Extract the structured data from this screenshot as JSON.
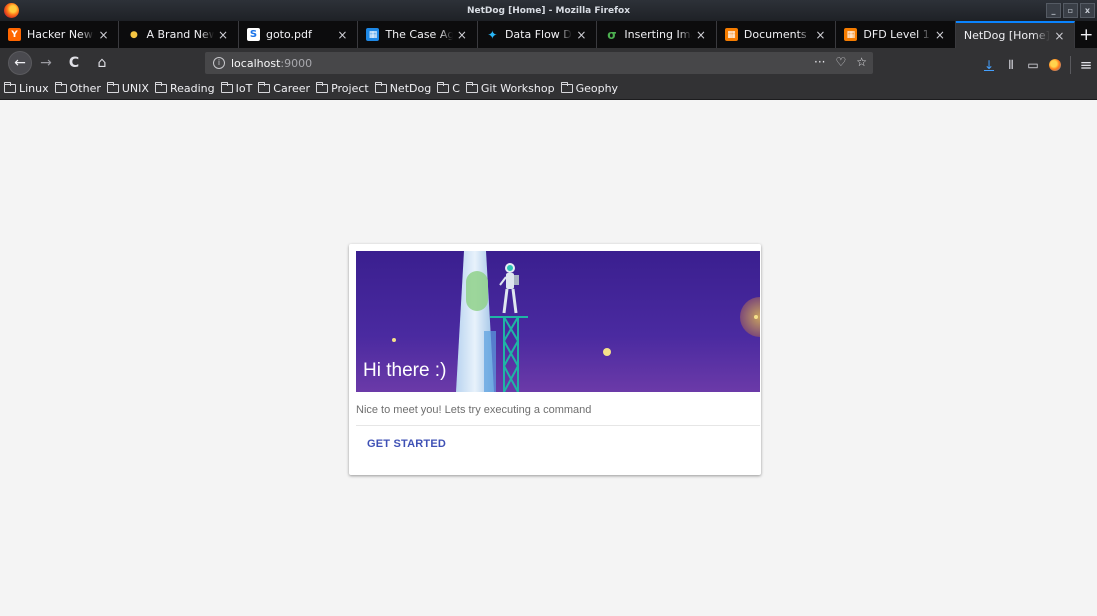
{
  "window": {
    "title": "NetDog [Home] - Mozilla Firefox",
    "controls": [
      "_",
      "▫",
      "x"
    ]
  },
  "tabs": [
    {
      "label": "Hacker News",
      "icon": "hacker-news-icon",
      "color": "#ff6600",
      "glyph": "Y"
    },
    {
      "label": "A Brand New",
      "icon": "lightbulb-icon",
      "color": "#f5c542",
      "glyph": "●"
    },
    {
      "label": "goto.pdf",
      "icon": "scribd-icon",
      "color": "#1a73e8",
      "glyph": "S"
    },
    {
      "label": "The Case Ag",
      "icon": "case-icon",
      "color": "#1e88e5",
      "glyph": "▦"
    },
    {
      "label": "Data Flow Di",
      "icon": "dataflow-icon",
      "color": "#29b6f6",
      "glyph": "✦"
    },
    {
      "label": "Inserting Ima",
      "icon": "inserting-icon",
      "color": "#4caf50",
      "glyph": "σ"
    },
    {
      "label": "Documents",
      "icon": "documents-icon",
      "color": "#f57c00",
      "glyph": "▦"
    },
    {
      "label": "DFD Level 1",
      "icon": "dfd-icon",
      "color": "#f57c00",
      "glyph": "▦"
    },
    {
      "label": "NetDog [Home]",
      "icon": "",
      "color": "",
      "glyph": "",
      "active": true
    }
  ],
  "tab_close": "×",
  "new_tab": "+",
  "nav": {
    "back": "←",
    "forward": "→",
    "reload": "C",
    "home": "⌂",
    "info": "i",
    "url_host": "localhost",
    "url_port": ":9000",
    "more": "···",
    "pocket": "♡",
    "star": "☆",
    "download": "↓",
    "library": "⫴",
    "sidebar": "▭",
    "menu": "≡"
  },
  "bookmarks": [
    "Linux",
    "Other",
    "UNIX",
    "Reading",
    "IoT",
    "Career",
    "Project",
    "NetDog",
    "C",
    "Git Workshop",
    "Geophy"
  ],
  "card": {
    "title": "Hi there :)",
    "text": "Nice to meet you! Lets try executing a command",
    "action": "GET STARTED",
    "accent": "#3f51b5"
  }
}
